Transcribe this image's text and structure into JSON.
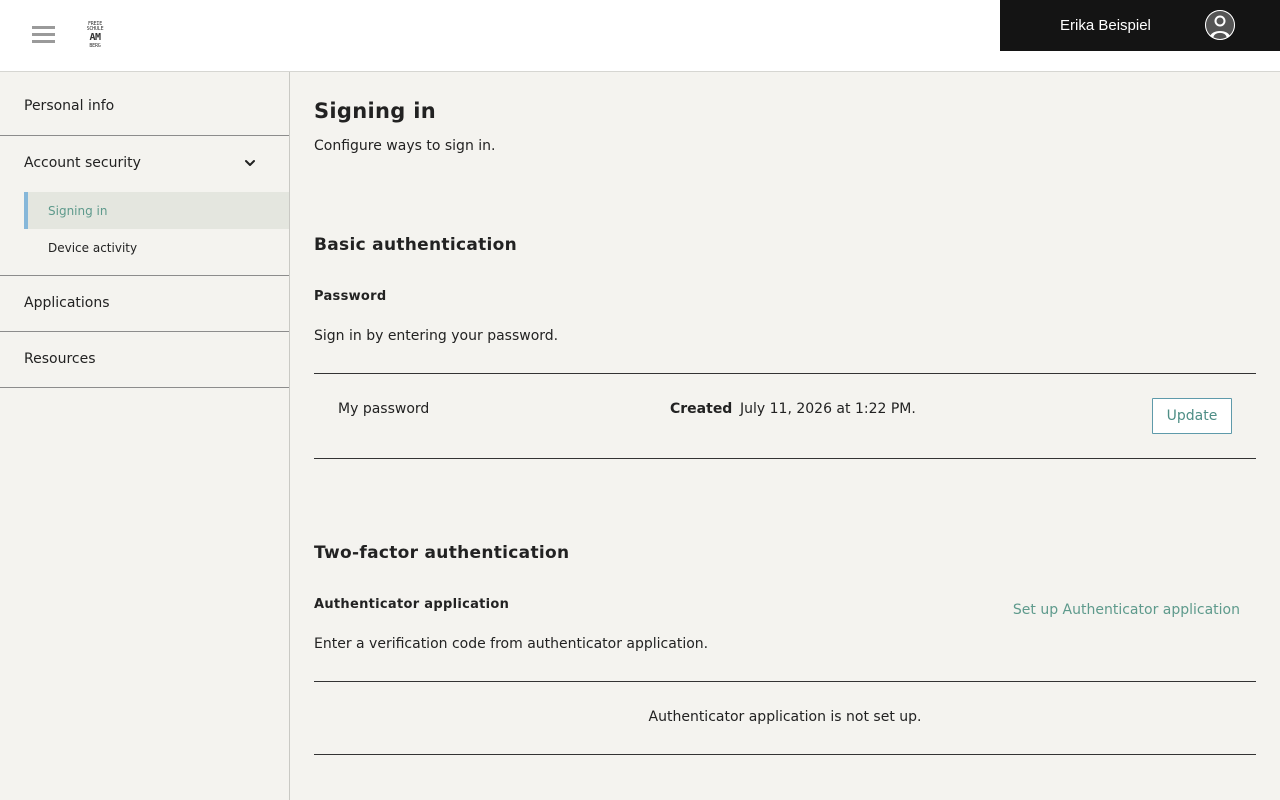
{
  "header": {
    "logo": {
      "line1": "FREIE",
      "line2": "SCHULE",
      "big": "AM",
      "line3": "BERG"
    },
    "user_name": "Erika Beispiel"
  },
  "sidebar": {
    "items": [
      {
        "label": "Personal info"
      },
      {
        "label": "Account security",
        "expanded": true,
        "children": [
          {
            "label": "Signing in",
            "active": true
          },
          {
            "label": "Device activity"
          }
        ]
      },
      {
        "label": "Applications"
      },
      {
        "label": "Resources"
      }
    ]
  },
  "main": {
    "title": "Signing in",
    "description": "Configure ways to sign in.",
    "basic": {
      "heading": "Basic authentication",
      "password": {
        "subheading": "Password",
        "description": "Sign in by entering your password.",
        "item_name": "My password",
        "created_label": "Created",
        "created_value": "July 11, 2026 at 1:22 PM.",
        "update_label": "Update"
      }
    },
    "twofactor": {
      "heading": "Two-factor authentication",
      "authenticator": {
        "subheading": "Authenticator application",
        "setup_link": "Set up Authenticator application",
        "description": "Enter a verification code from authenticator application.",
        "status": "Authenticator application is not set up."
      }
    }
  },
  "colors": {
    "accent": "#5e9a8c",
    "active_bar": "#86b7d9",
    "header_dark": "#141414",
    "background": "#f4f3ef"
  }
}
